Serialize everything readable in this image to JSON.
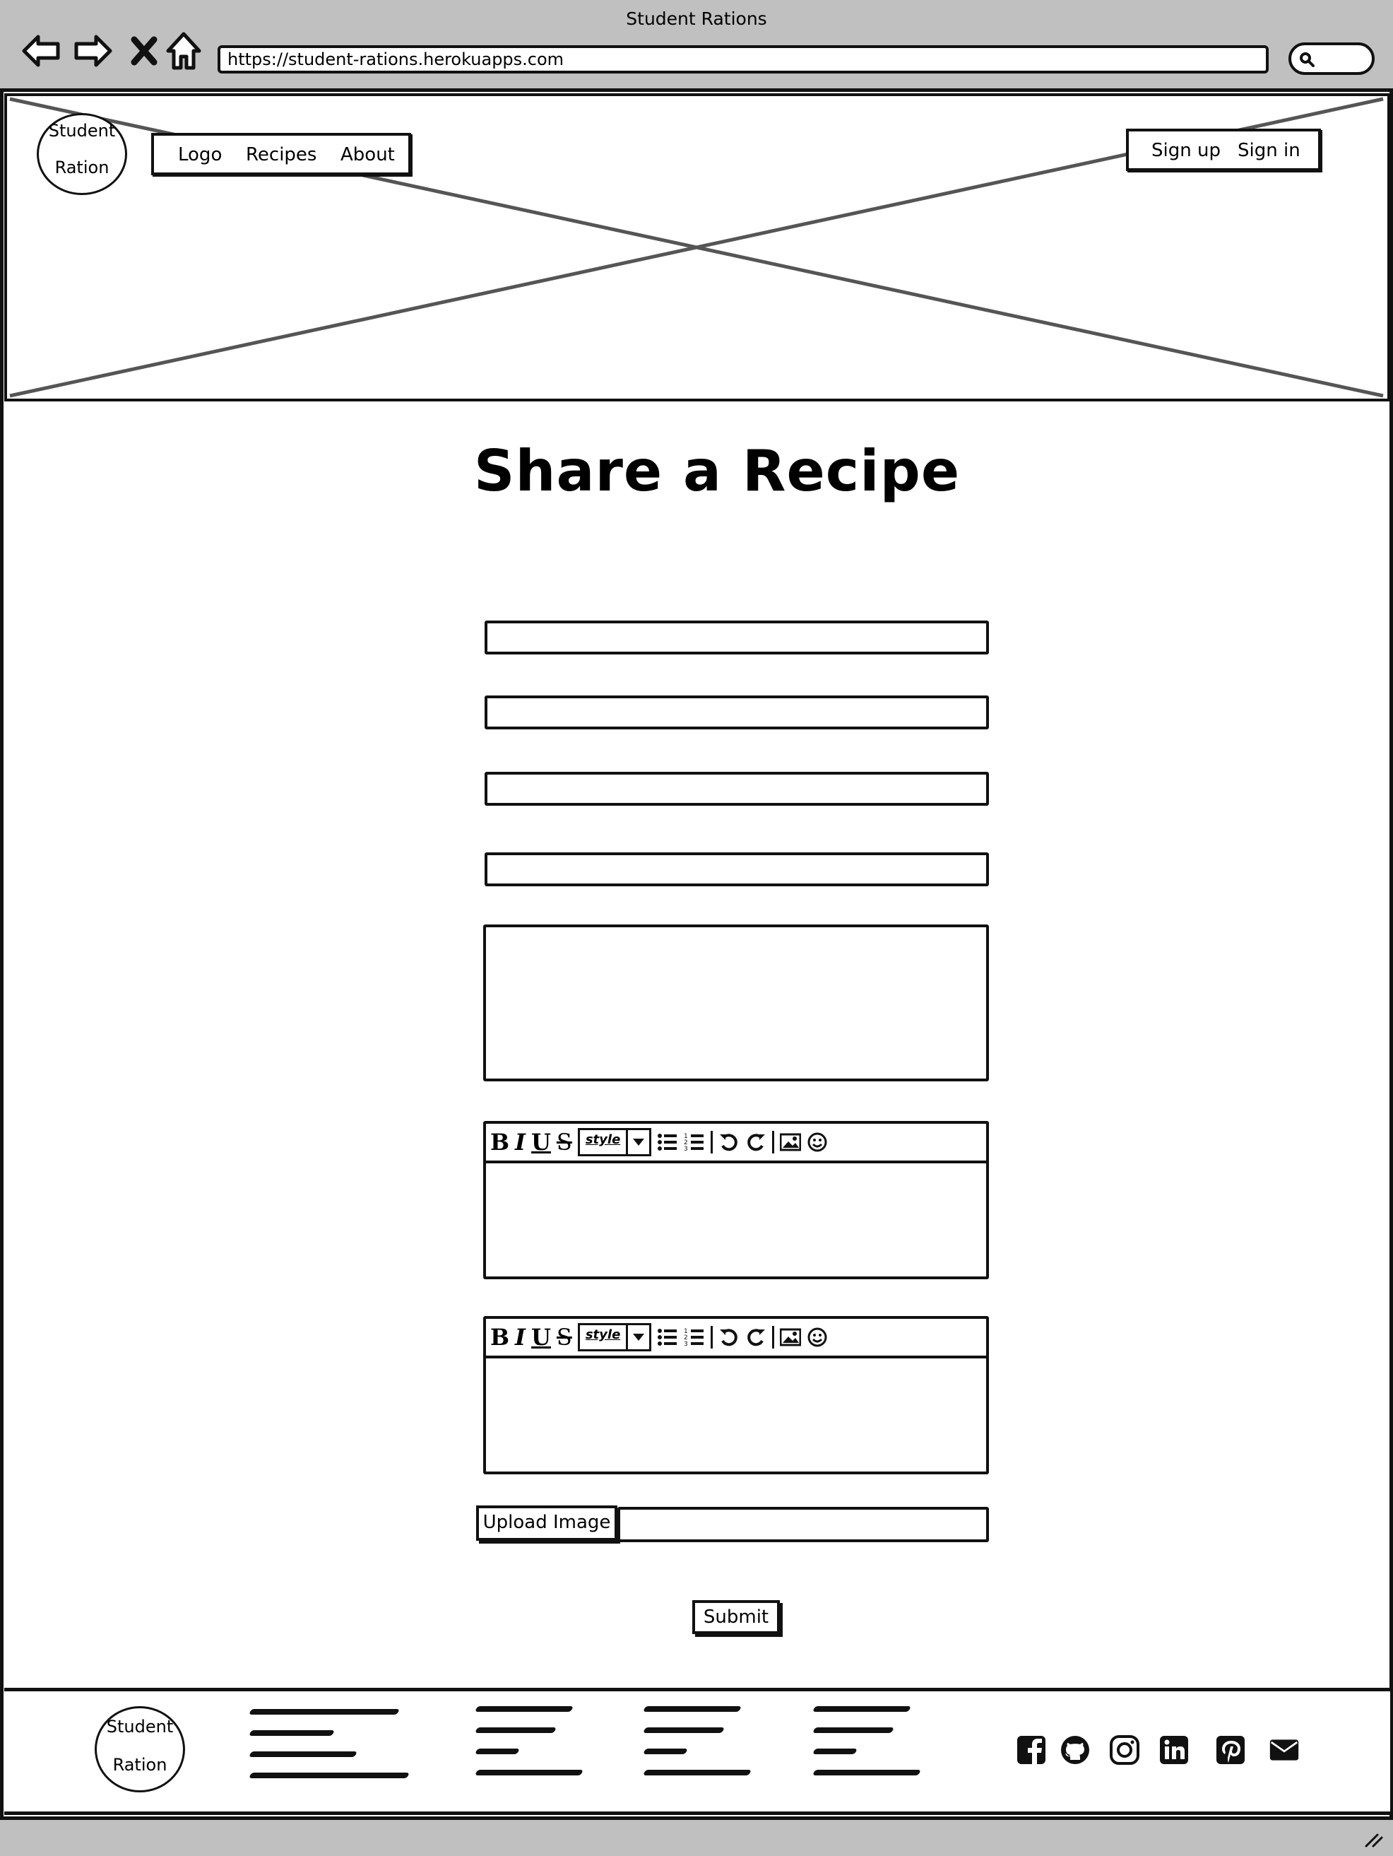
{
  "browser": {
    "title": "Student Rations",
    "url": "https://student-rations.herokuapps.com"
  },
  "header": {
    "logo_line1": "Student",
    "logo_line2": "Ration",
    "nav": [
      "Logo",
      "Recipes",
      "About"
    ],
    "auth": [
      "Sign up",
      "Sign in"
    ]
  },
  "main": {
    "heading": "Share a Recipe",
    "editor_style_label": "style",
    "upload_label": "Upload Image",
    "submit_label": "Submit"
  },
  "footer": {
    "logo_line1": "Student",
    "logo_line2": "Ration",
    "social_icons": [
      "facebook-icon",
      "github-icon",
      "instagram-icon",
      "linkedin-icon",
      "pinterest-icon",
      "email-icon"
    ]
  }
}
